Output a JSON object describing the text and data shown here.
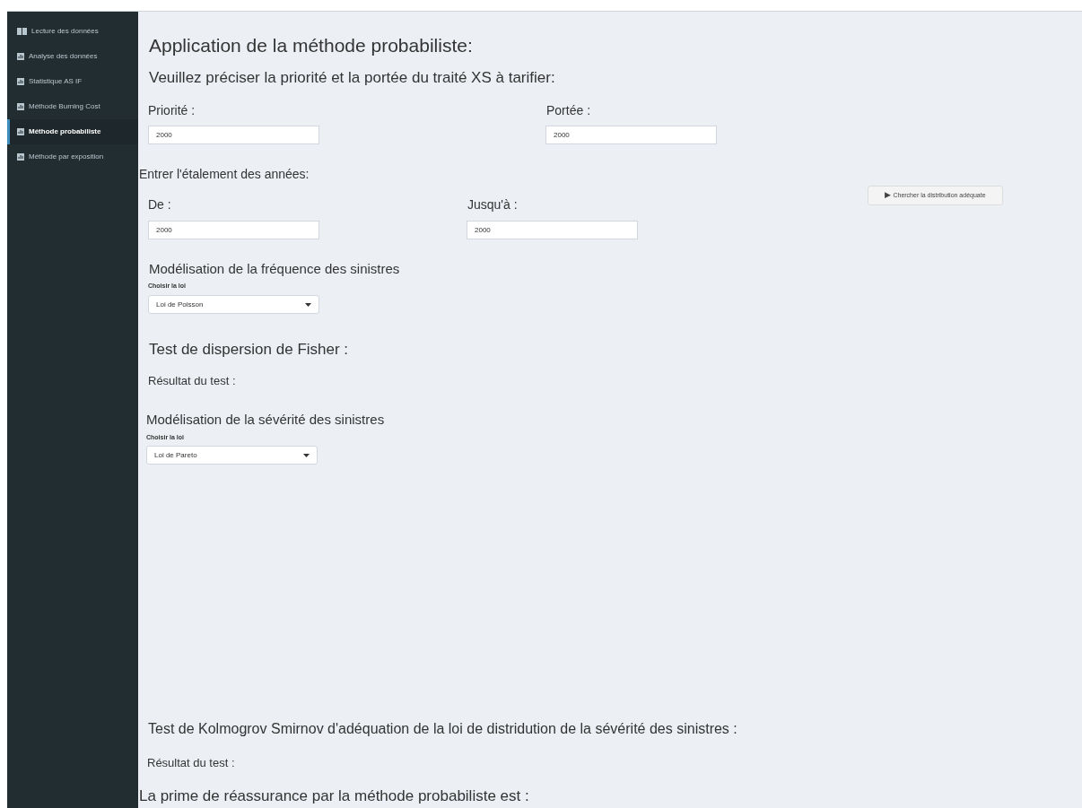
{
  "sidebar": {
    "items": [
      {
        "label": "Lecture des données",
        "kind": "book",
        "selected": false
      },
      {
        "label": "Analyse des données",
        "kind": "chart",
        "selected": false
      },
      {
        "label": "Statistique AS IF",
        "kind": "chart",
        "selected": false
      },
      {
        "label": "Méthode Burning Cost",
        "kind": "chart",
        "selected": false
      },
      {
        "label": "Méthode probabiliste",
        "kind": "chart",
        "selected": true
      },
      {
        "label": "Méthode par exposition",
        "kind": "chart",
        "selected": false
      }
    ]
  },
  "main": {
    "title": "Application de la méthode probabiliste:",
    "subtitle": "Veuillez préciser la priorité et la portée du traité XS à tarifier:",
    "priority": {
      "label": "Priorité :",
      "value": "2000"
    },
    "scope": {
      "label": "Portée :",
      "value": "2000"
    },
    "years_heading": "Entrer l'étalement des années:",
    "from": {
      "label": "De :",
      "value": "2000"
    },
    "to": {
      "label": "Jusqu'à :",
      "value": "2000"
    },
    "search_button": {
      "icon": "▶",
      "label": "Chercher la distribution adéquate"
    },
    "frequency": {
      "heading": "Modélisation de la fréquence des sinistres",
      "select_label": "Choisir la loi",
      "value": "Loi de Poisson"
    },
    "fisher": {
      "heading": "Test de dispersion de Fisher :",
      "result": "Résultat du test :"
    },
    "severity": {
      "heading": "Modélisation de la sévérité des sinistres",
      "select_label": "Choisir la loi",
      "value": "Loi de Pareto"
    },
    "ks": {
      "heading": "Test de Kolmogrov Smirnov d'adéquation de la loi de distridution de la sévérité des sinistres :",
      "result": "Résultat du test :"
    },
    "premium": "La prime de réassurance par la méthode probabiliste est :"
  }
}
